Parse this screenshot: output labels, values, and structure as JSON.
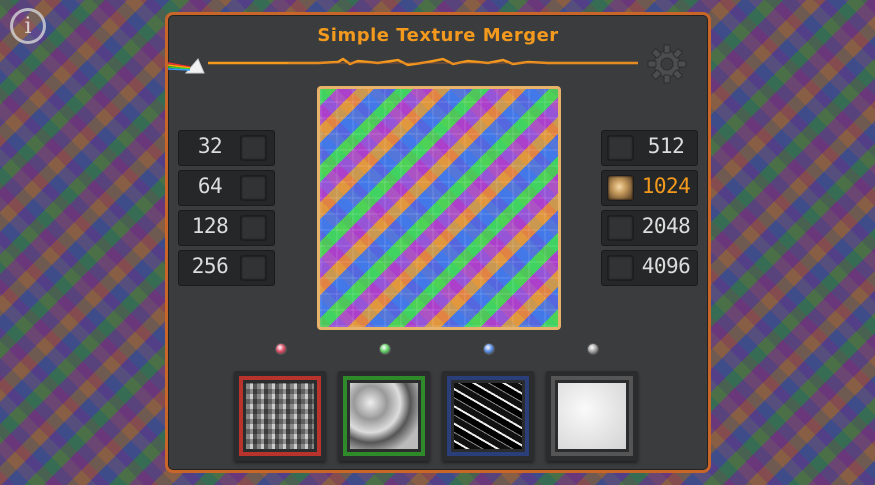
{
  "app": {
    "title": "Simple Texture Merger",
    "info_glyph": "i"
  },
  "colors": {
    "accent": "#f39a1e",
    "frame": "#c8662a",
    "panel": "#3b3c3e"
  },
  "icons": {
    "info": "info-icon",
    "settings": "gear-icon",
    "prism": "prism-icon"
  },
  "resolutions": {
    "left": [
      {
        "label": "32",
        "checked": false
      },
      {
        "label": "64",
        "checked": false
      },
      {
        "label": "128",
        "checked": false
      },
      {
        "label": "256",
        "checked": false
      }
    ],
    "right": [
      {
        "label": "512",
        "checked": false
      },
      {
        "label": "1024",
        "checked": true
      },
      {
        "label": "2048",
        "checked": false
      },
      {
        "label": "4096",
        "checked": false
      }
    ]
  },
  "channels": [
    {
      "led_color": "#e0506a",
      "frame_color": "#b8332c"
    },
    {
      "led_color": "#66d26a",
      "frame_color": "#2f8a2a"
    },
    {
      "led_color": "#5a8ee6",
      "frame_color": "#2a3f7a"
    },
    {
      "led_color": "#a8a8a8",
      "frame_color": "#555555"
    }
  ]
}
